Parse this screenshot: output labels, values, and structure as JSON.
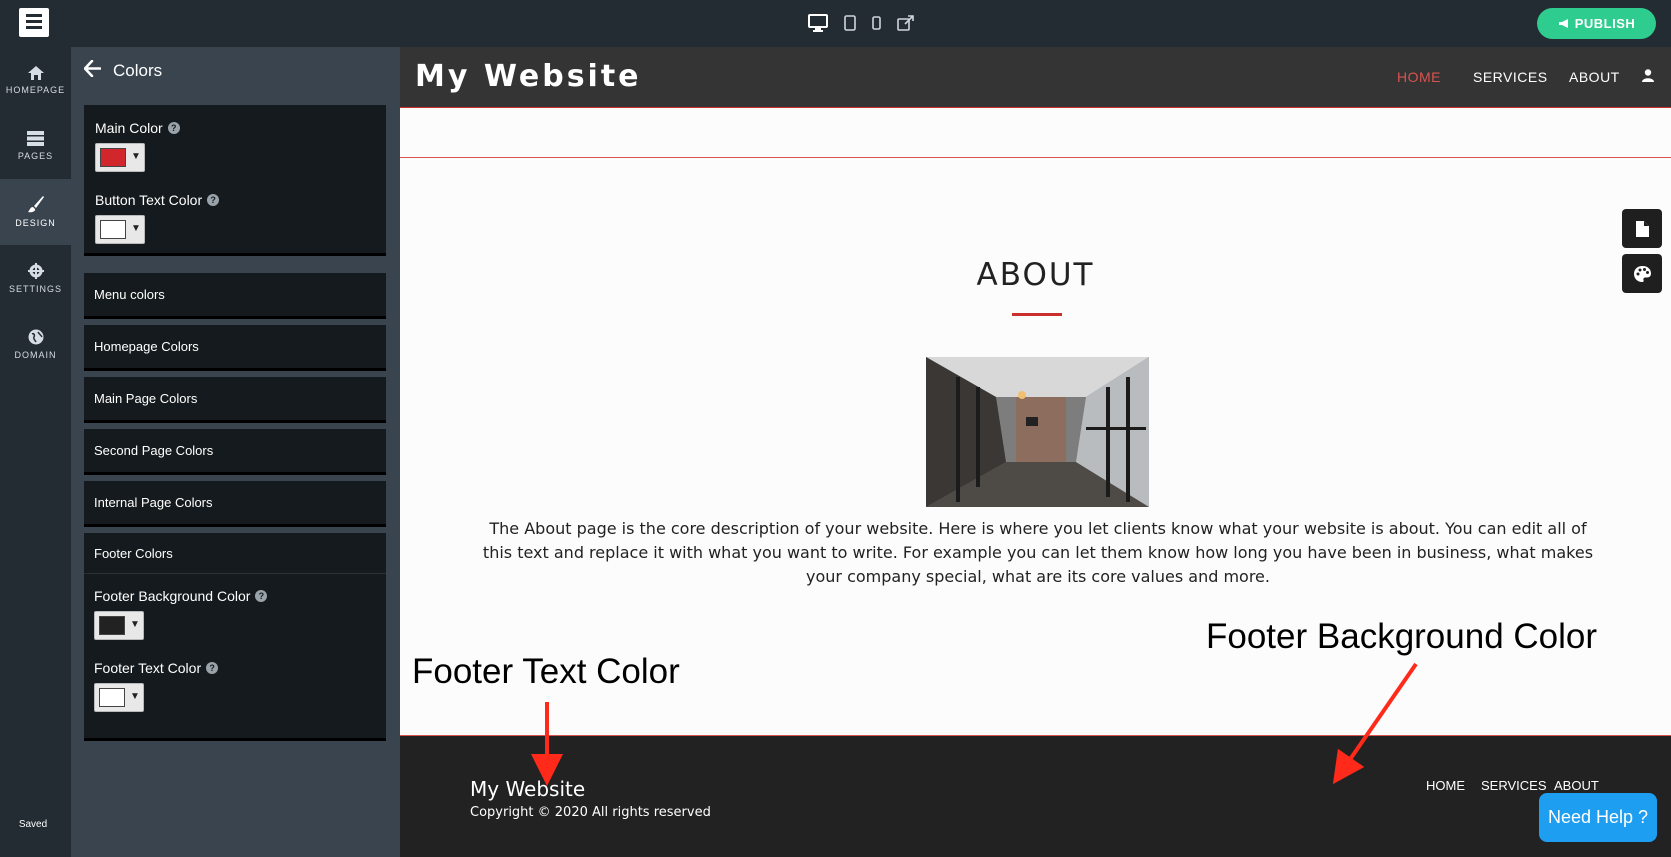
{
  "topbar": {
    "publish_label": "PUBLISH",
    "device_icons": [
      "desktop-icon",
      "tablet-icon",
      "mobile-icon",
      "external-link-icon"
    ]
  },
  "leftnav": {
    "items": [
      {
        "label": "HOMEPAGE",
        "icon": "home-icon"
      },
      {
        "label": "PAGES",
        "icon": "pages-icon"
      },
      {
        "label": "DESIGN",
        "icon": "brush-icon",
        "active": true
      },
      {
        "label": "SETTINGS",
        "icon": "gear-icon"
      },
      {
        "label": "DOMAIN",
        "icon": "globe-icon"
      }
    ],
    "status": "Saved"
  },
  "panel": {
    "title": "Colors",
    "main_color_label": "Main Color",
    "button_text_color_label": "Button Text Color",
    "sections": [
      "Menu colors",
      "Homepage Colors",
      "Main Page Colors",
      "Second Page Colors",
      "Internal Page Colors"
    ],
    "footer_section": {
      "title": "Footer Colors",
      "bg_label": "Footer Background Color",
      "text_label": "Footer Text Color"
    },
    "colors": {
      "main": "#d0262c",
      "button_text": "#ffffff",
      "footer_bg": "#222222",
      "footer_text": "#ffffff"
    }
  },
  "preview": {
    "site_title": "My Website",
    "nav": [
      "HOME",
      "SERVICES",
      "ABOUT"
    ],
    "about_title": "ABOUT",
    "about_text": "The About page is the core description of your website. Here is where you let clients know what your website is about. You can edit all of this text and replace it with what you want to write. For example you can let them know how long you have been in business, what makes your company special, what are its core values and more.",
    "footer_title": "My Website",
    "footer_copy": "Copyright © 2020 All rights reserved",
    "footer_nav": [
      "HOME",
      "SERVICES",
      "ABOUT"
    ],
    "annotations": {
      "footer_text": "Footer Text Color",
      "footer_bg": "Footer Background Color"
    },
    "accent": "#d9534f"
  },
  "help_label": "Need Help ?"
}
